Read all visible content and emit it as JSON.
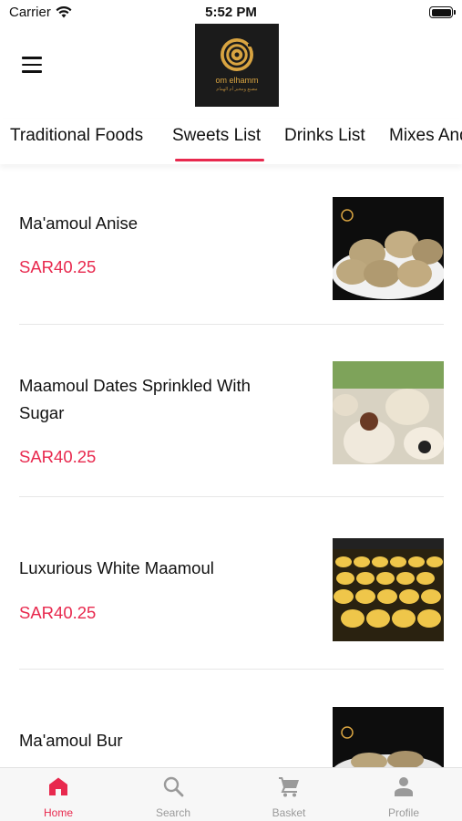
{
  "status_bar": {
    "carrier": "Carrier",
    "time": "5:52 PM"
  },
  "header": {
    "logo_text": "om elhamm",
    "logo_subtext": "مصنع ومخبز أم الهمام"
  },
  "tabs": [
    {
      "label": "Traditional Foods",
      "active": false
    },
    {
      "label": "Sweets List",
      "active": true
    },
    {
      "label": "Drinks List",
      "active": false
    },
    {
      "label": "Mixes And",
      "active": false
    }
  ],
  "products": [
    {
      "name": "Ma'amoul  Anise",
      "price": "SAR40.25",
      "image": "anise-maamoul-photo"
    },
    {
      "name": "Maamoul Dates Sprinkled With Sugar",
      "price": "SAR40.25",
      "image": "dates-maamoul-photo"
    },
    {
      "name": "Luxurious White Maamoul",
      "price": "SAR40.25",
      "image": "white-maamoul-photo"
    },
    {
      "name": "Ma'amoul Bur",
      "price": "",
      "image": "bur-maamoul-photo"
    }
  ],
  "tabbar": [
    {
      "label": "Home",
      "icon": "home-icon",
      "active": true
    },
    {
      "label": "Search",
      "icon": "search-icon",
      "active": false
    },
    {
      "label": "Basket",
      "icon": "cart-icon",
      "active": false
    },
    {
      "label": "Profile",
      "icon": "person-icon",
      "active": false
    }
  ],
  "colors": {
    "accent": "#e8294e",
    "text": "#111111",
    "inactive": "#9a9a9a",
    "logo_gold": "#d9a441"
  }
}
